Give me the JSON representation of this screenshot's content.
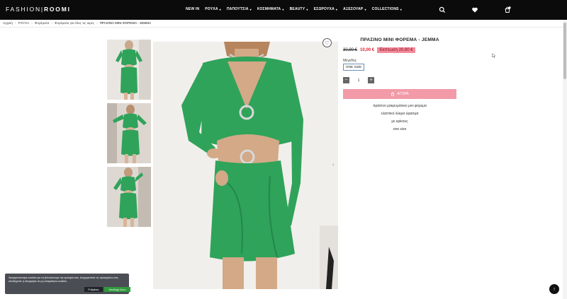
{
  "header": {
    "logo_left": "FASHION",
    "logo_right": "ROOMI",
    "nav": [
      {
        "label": "NEW IN",
        "chevron": false
      },
      {
        "label": "ΡΟΥΧΑ",
        "chevron": true
      },
      {
        "label": "ΠΑΠΟΥΤΣΙΑ",
        "chevron": true
      },
      {
        "label": "ΚΟΣΜΗΜΑΤΑ",
        "chevron": true
      },
      {
        "label": "BEAUTY",
        "chevron": true
      },
      {
        "label": "ΕΣΩΡΟΥΧΑ",
        "chevron": true
      },
      {
        "label": "ΑΞΕΣΟΥΑΡ",
        "chevron": true
      },
      {
        "label": "COLLECTIONS",
        "chevron": true
      }
    ],
    "icons": [
      "search-icon",
      "heart-icon",
      "cart-icon"
    ],
    "cart_count": "0"
  },
  "breadcrumb": [
    "Αρχική",
    "ΡΟΥΧΑ",
    "Φορέματα",
    "Φορέματα για όλες τις ώρες",
    "ΠΡΑΣΙΝΟ MINI ΦΟΡΕΜΑ - JEMMA"
  ],
  "product": {
    "title": "ΠΡΑΣΙΝΟ MINI ΦΟΡΕΜΑ - JEMMA",
    "old_price": "30,90 €",
    "new_price": "10,00 €",
    "discount": "Έκπτωση 20,90 €",
    "size_label": "Μέγεθος",
    "size_option": "ONE SIZE",
    "qty": "1",
    "buy_label": "ΑΓΟΡΑ",
    "description": [
      "πράσινο μακρυμάνικο μινι φόρεμα",
      "ελαστικό λύκρα ύφασμα",
      "με κρίκους",
      "one size"
    ],
    "dress_color": "#2fa35a"
  },
  "cookie": {
    "text": "Χρησιμοποιούμε cookies για να βελτιώσουμε την εμπειρία σας. Διαχειριστείτε τις προτιμήσεις σας, αποδεχτείτε ή απορρίψτε τα μη απαραίτητα cookies.",
    "settings_label": "Ρυθμίσεις",
    "accept_label": "Αποδοχή όλων"
  }
}
